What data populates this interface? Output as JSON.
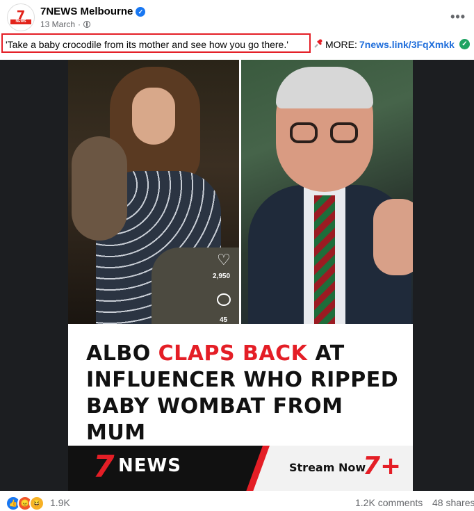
{
  "post": {
    "page_name": "7NEWS Melbourne",
    "date": "13 March",
    "separator": "·",
    "caption_quote": "'Take a baby crocodile from its mother and see how you go there.'",
    "more_label": "MORE:",
    "link_text": "7news.link/3FqXmkk"
  },
  "avatar": {
    "seven": "7",
    "news": "NEWS"
  },
  "video_overlay": {
    "likes": "2,950",
    "comments": "45"
  },
  "headline": {
    "part1": "ALBO ",
    "part2": "CLAPS BACK",
    "part3": " AT INFLUENCER WHO RIPPED BABY WOMBAT FROM MUM"
  },
  "brand": {
    "logo_seven": "7",
    "logo_news": "NEWS",
    "stream_label": "Stream Now",
    "logo_seven_plus": "7+"
  },
  "footer": {
    "reaction_count": "1.9K",
    "comments": "1.2K comments",
    "shares": "48 shares"
  },
  "icons": [
    "verified-icon",
    "globe-icon",
    "more-icon",
    "pin-icon",
    "check-icon",
    "like-icon",
    "angry-icon",
    "haha-icon",
    "heart-icon",
    "comment-icon"
  ],
  "colors": {
    "link": "#216fdb",
    "highlight_box": "#e41e26",
    "brand_red": "#e41e26",
    "facebook_blue": "#1877f2"
  }
}
